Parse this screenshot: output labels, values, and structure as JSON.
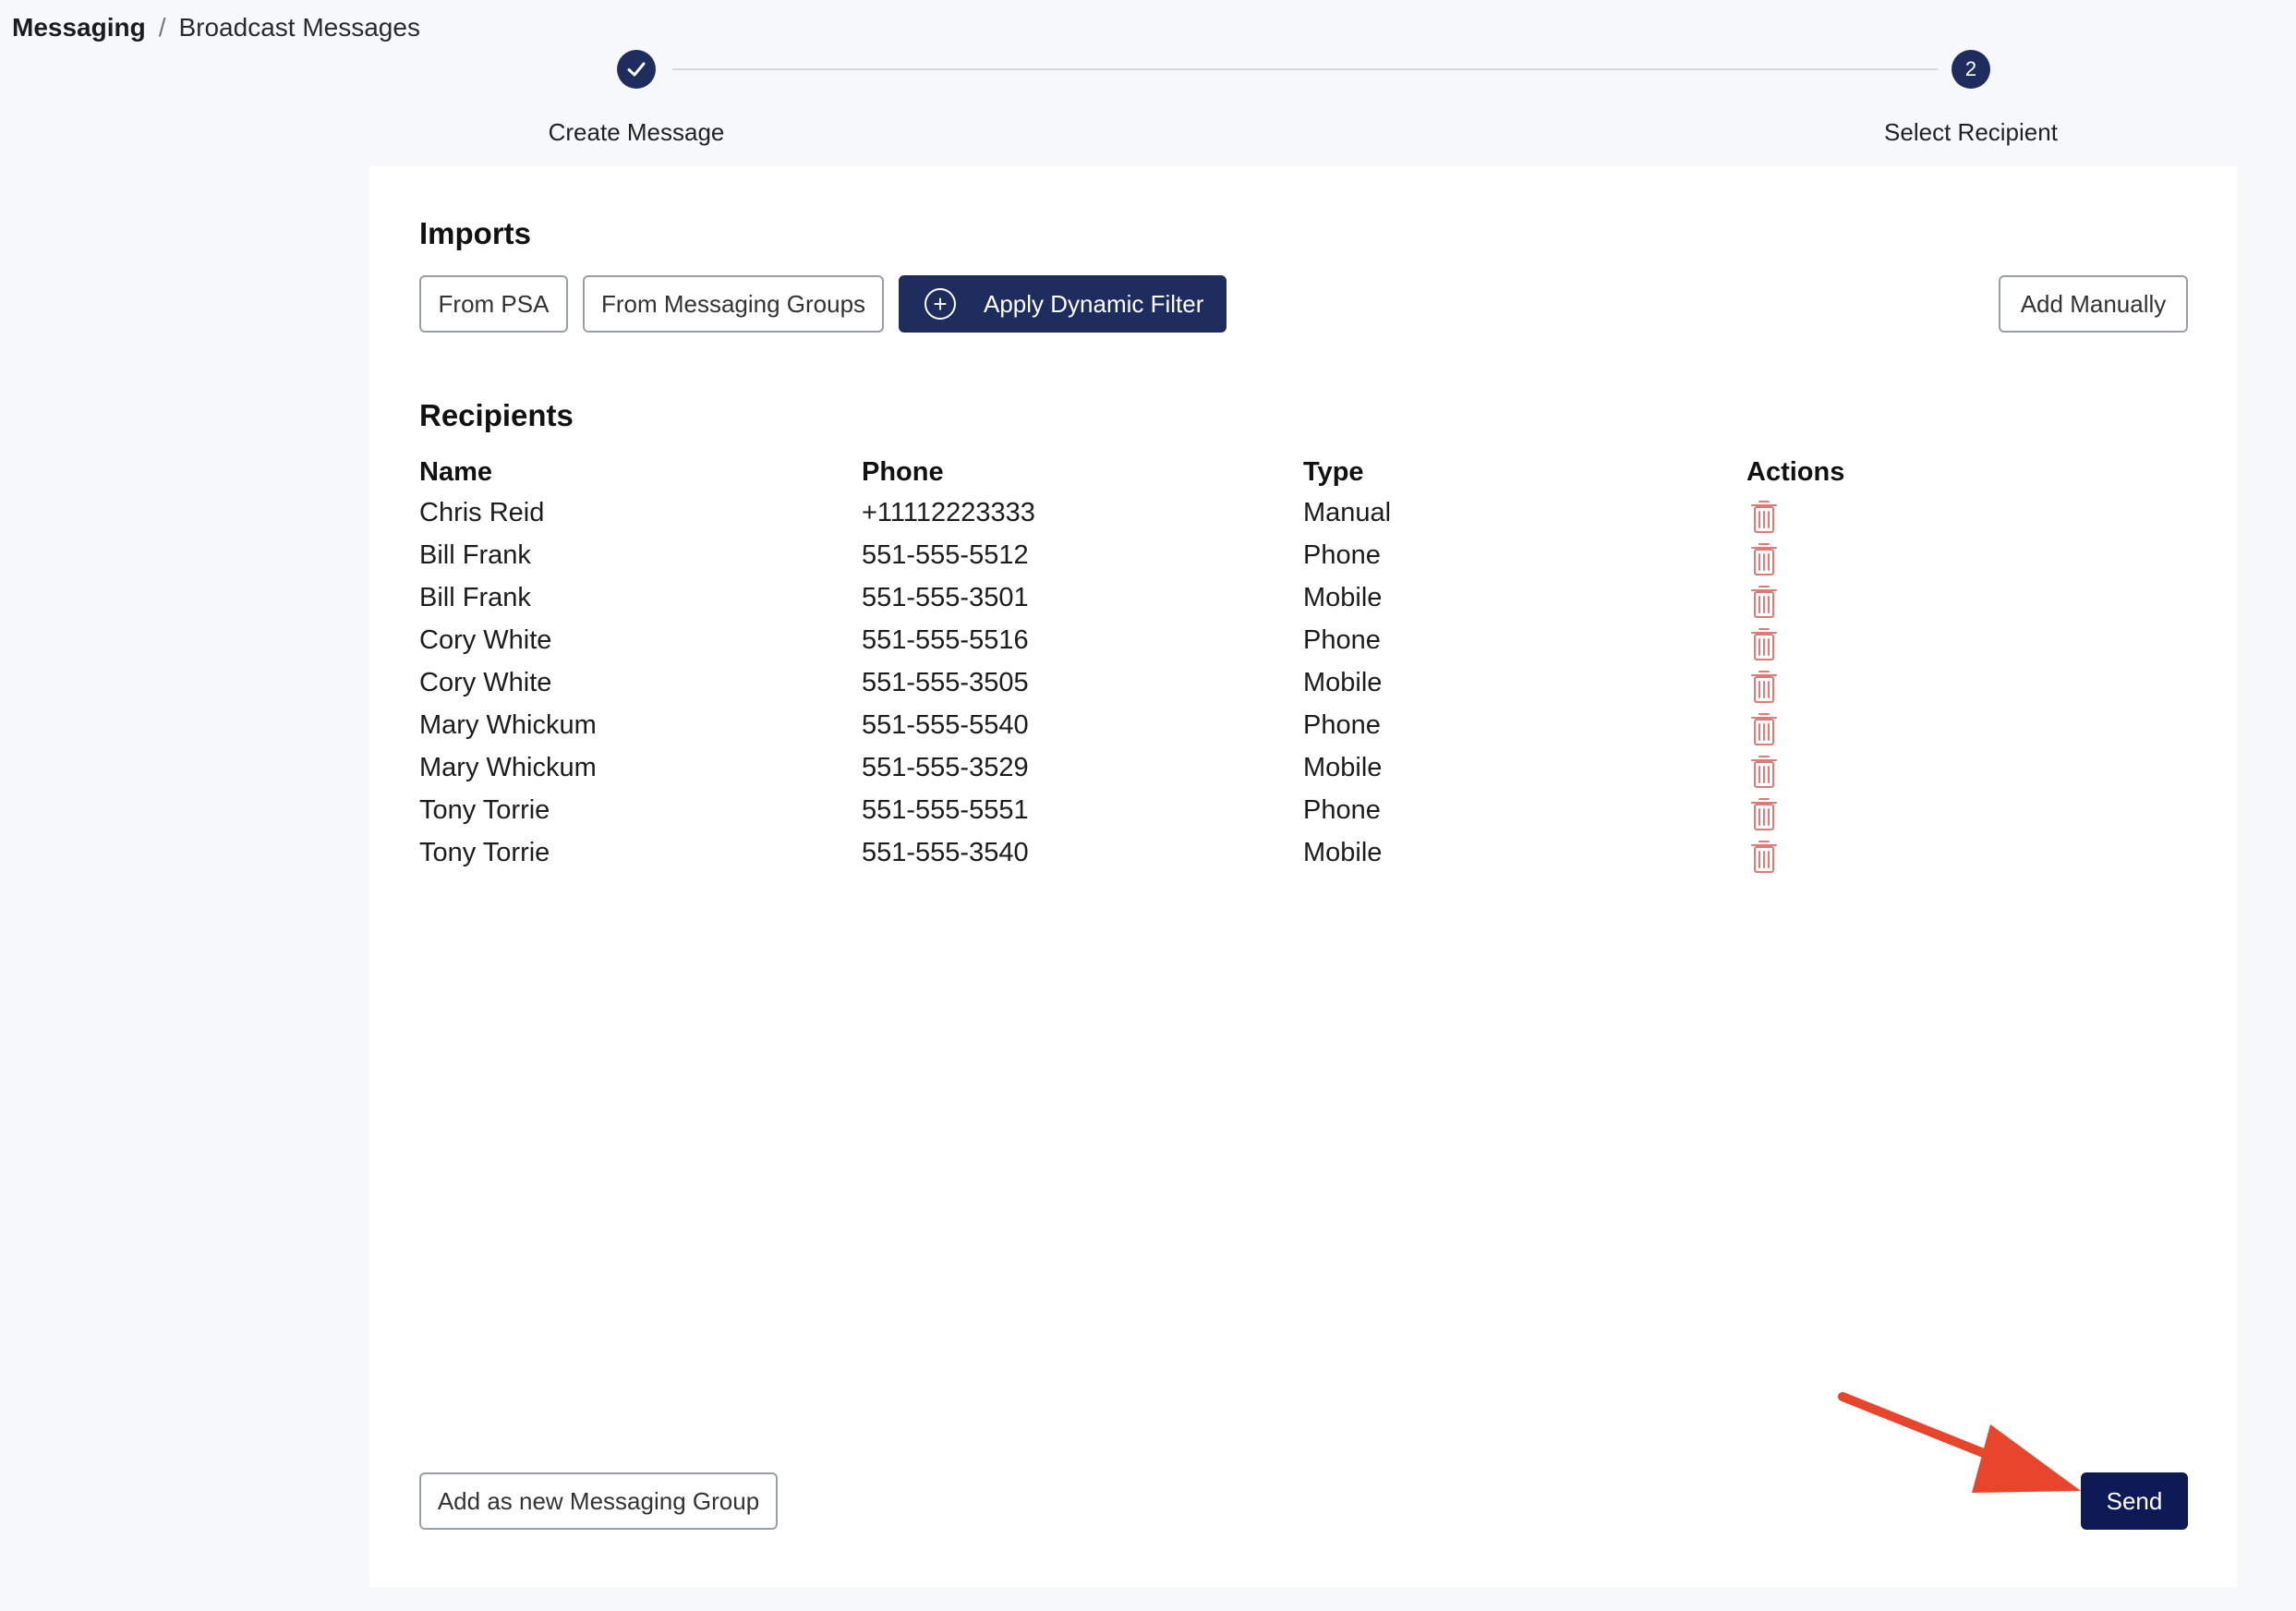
{
  "breadcrumb": {
    "root": "Messaging",
    "separator": "/",
    "current": "Broadcast Messages"
  },
  "stepper": {
    "steps": [
      {
        "label": "Create Message",
        "state": "completed",
        "icon": "check-icon"
      },
      {
        "label": "Select Recipient",
        "number": "2",
        "state": "active"
      }
    ]
  },
  "imports": {
    "title": "Imports",
    "from_psa": "From PSA",
    "from_groups": "From Messaging Groups",
    "apply_filter": "Apply Dynamic Filter",
    "apply_filter_icon": "plus-circle-icon",
    "add_manually": "Add Manually"
  },
  "recipients": {
    "title": "Recipients",
    "columns": {
      "name": "Name",
      "phone": "Phone",
      "type": "Type",
      "actions": "Actions"
    },
    "action_icon": "trash-icon",
    "rows": [
      {
        "name": "Chris Reid",
        "phone": "+11112223333",
        "type": "Manual"
      },
      {
        "name": "Bill Frank",
        "phone": "551-555-5512",
        "type": "Phone"
      },
      {
        "name": "Bill Frank",
        "phone": "551-555-3501",
        "type": "Mobile"
      },
      {
        "name": "Cory White",
        "phone": "551-555-5516",
        "type": "Phone"
      },
      {
        "name": "Cory White",
        "phone": "551-555-3505",
        "type": "Mobile"
      },
      {
        "name": "Mary Whickum",
        "phone": "551-555-5540",
        "type": "Phone"
      },
      {
        "name": "Mary Whickum",
        "phone": "551-555-3529",
        "type": "Mobile"
      },
      {
        "name": "Tony Torrie",
        "phone": "551-555-5551",
        "type": "Phone"
      },
      {
        "name": "Tony Torrie",
        "phone": "551-555-3540",
        "type": "Mobile"
      }
    ]
  },
  "footer": {
    "add_group": "Add as new Messaging Group",
    "send": "Send"
  },
  "colors": {
    "primary": "#1f2d5e",
    "send": "#0e1a55",
    "trash": "#e07a7a",
    "annotation_arrow": "#e8452c",
    "background": "#f7f8fa"
  }
}
